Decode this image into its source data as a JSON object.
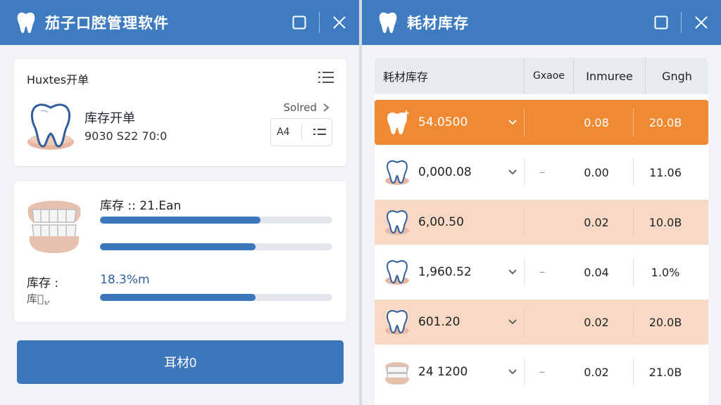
{
  "left": {
    "title": "茄子口腔管理软件",
    "order_card": {
      "title": "Huxtes开单",
      "order_title": "库存开单",
      "order_code": "9030 S22  70:0",
      "sorted_label": "Solred",
      "mini_a": "A4"
    },
    "stock_card": {
      "stock_label": "库存 :: 21.Ean",
      "bar1_fill": 0.69,
      "bar2_fill": 0.67,
      "stock2_label": "库存 :",
      "stock2_sub": "库程ٍ..",
      "percent": "18.3%m",
      "bar3_fill": 0.67
    },
    "button_label": "耳材0"
  },
  "right": {
    "title": "耗材库存",
    "table": {
      "headers": [
        "耗材库存",
        "Gxaoe",
        "Inmuree",
        "Gngh"
      ],
      "rows": [
        {
          "value": "54.0500",
          "dash": "",
          "n1": "0.08",
          "n2": "20.0B",
          "style": "selected",
          "chevron": true
        },
        {
          "value": "0,000.08",
          "dash": "–",
          "n1": "0.00",
          "n2": "11.06",
          "style": "white",
          "chevron": true
        },
        {
          "value": "6,00.50",
          "dash": "",
          "n1": "0.02",
          "n2": "10.0B",
          "style": "peach",
          "chevron": false
        },
        {
          "value": "1,960.52",
          "dash": "–",
          "n1": "0.04",
          "n2": "1.0%",
          "style": "white",
          "chevron": true
        },
        {
          "value": "601.20",
          "dash": "",
          "n1": "0.02",
          "n2": "20.0B",
          "style": "peach",
          "chevron": true
        },
        {
          "value": "24 1200",
          "dash": "–",
          "n1": "0.02",
          "n2": "21.0B",
          "style": "white",
          "chevron": true
        }
      ]
    }
  },
  "colors": {
    "titlebar": "#3f7bc0",
    "accent": "#3d77bb",
    "selected_row": "#f08a32",
    "peach_row": "#f8d9c6"
  }
}
